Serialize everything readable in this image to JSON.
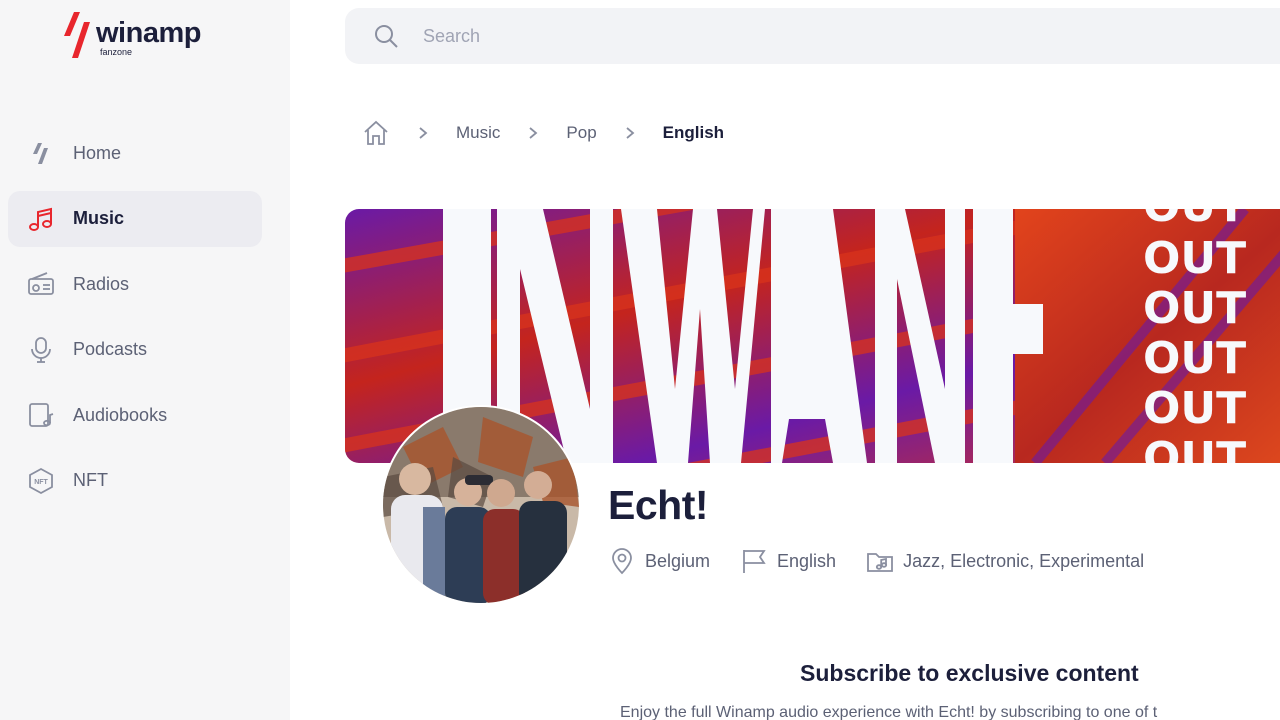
{
  "brand": {
    "name": "winamp",
    "sub": "fanzone",
    "accent": "#e8262d"
  },
  "sidebar": {
    "items": [
      {
        "label": "Home",
        "icon": "winamp-bolt-icon",
        "active": false
      },
      {
        "label": "Music",
        "icon": "music-note-icon",
        "active": true
      },
      {
        "label": "Radios",
        "icon": "radio-icon",
        "active": false
      },
      {
        "label": "Podcasts",
        "icon": "microphone-icon",
        "active": false
      },
      {
        "label": "Audiobooks",
        "icon": "audiobook-icon",
        "active": false
      },
      {
        "label": "NFT",
        "icon": "nft-hexagon-icon",
        "active": false
      }
    ]
  },
  "search": {
    "placeholder": "Search",
    "value": ""
  },
  "breadcrumb": {
    "items": [
      "Music",
      "Pop"
    ],
    "current": "English"
  },
  "banner": {
    "headline_letters": "INWANI",
    "repeat_word": "OUT"
  },
  "artist": {
    "name": "Echt!",
    "location": "Belgium",
    "language": "English",
    "genres": "Jazz, Electronic, Experimental"
  },
  "subscribe": {
    "title": "Subscribe to exclusive content",
    "description": "Enjoy the full Winamp audio experience with Echt! by subscribing to one of t"
  },
  "colors": {
    "text_primary": "#1c1f3b",
    "text_secondary": "#5c6175",
    "sidebar_bg": "#f6f6f7",
    "active_bg": "#ececf1",
    "banner_red": "#d9331c",
    "banner_purple": "#6a1aa6"
  }
}
